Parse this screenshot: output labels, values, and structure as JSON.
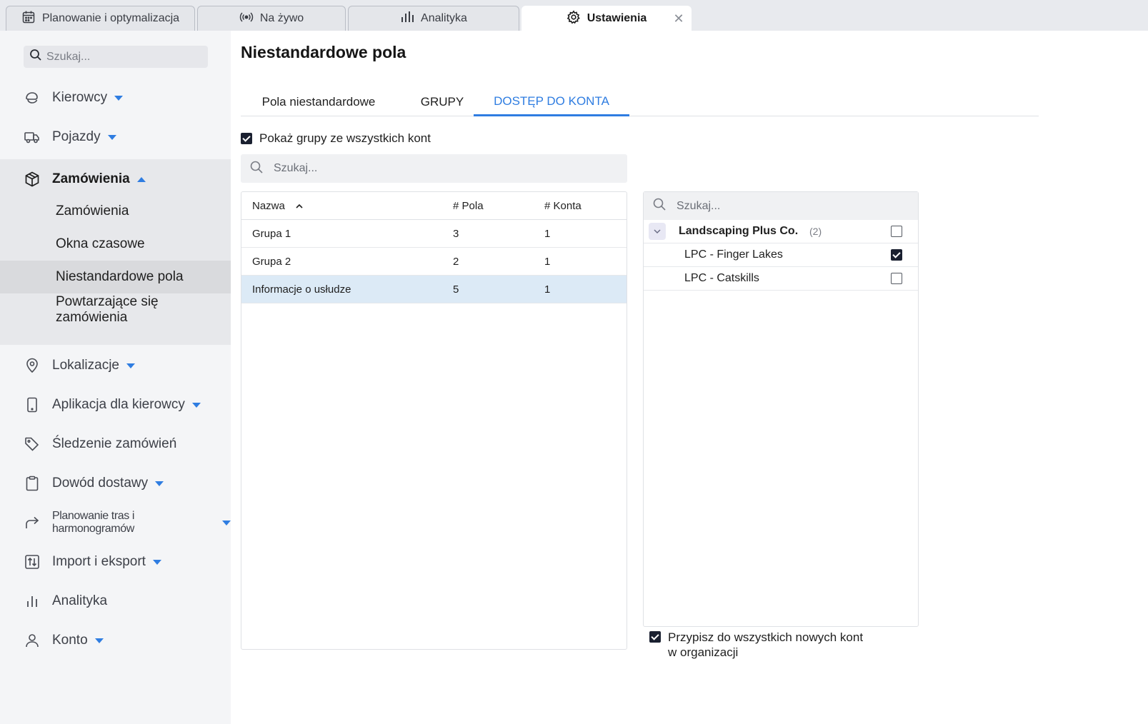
{
  "tabs": [
    {
      "label": "Planowanie i optymalizacja",
      "icon": "calendar-icon"
    },
    {
      "label": "Na żywo",
      "icon": "broadcast-icon"
    },
    {
      "label": "Analityka",
      "icon": "bar-chart-icon"
    },
    {
      "label": "Ustawienia",
      "icon": "gear-icon",
      "active": true
    }
  ],
  "tab_close": "✕",
  "sidebar": {
    "search_placeholder": "Szukaj...",
    "items": [
      {
        "label": "Kierowcy",
        "icon": "driver-icon",
        "caret": "down"
      },
      {
        "label": "Pojazdy",
        "icon": "truck-icon",
        "caret": "down"
      },
      {
        "label": "Zamówienia",
        "icon": "box-icon",
        "caret": "up",
        "open": true
      },
      {
        "label": "Lokalizacje",
        "icon": "location-pin-icon",
        "caret": "down"
      },
      {
        "label": "Aplikacja dla kierowcy",
        "icon": "phone-icon",
        "caret": "down"
      },
      {
        "label": "Śledzenie zamówień",
        "icon": "tag-icon"
      },
      {
        "label": "Dowód dostawy",
        "icon": "clipboard-icon",
        "caret": "down"
      },
      {
        "label": "Planowanie tras i harmonogramów",
        "icon": "route-arrow-icon",
        "caret": "down"
      },
      {
        "label": "Import i eksport",
        "icon": "import-export-icon",
        "caret": "down"
      },
      {
        "label": "Analityka",
        "icon": "analytics-icon"
      },
      {
        "label": "Konto",
        "icon": "user-icon",
        "caret": "down"
      }
    ],
    "sub_items": [
      {
        "label": "Zamówienia"
      },
      {
        "label": "Okna czasowe"
      },
      {
        "label": "Niestandardowe pola",
        "selected": true
      },
      {
        "label": "Powtarzające się zamówienia"
      }
    ]
  },
  "main": {
    "title": "Niestandardowe pola",
    "subtabs": [
      {
        "label": "Pola niestandardowe"
      },
      {
        "label": "GRUPY"
      },
      {
        "label": "DOSTĘP DO KONTA",
        "active": true
      }
    ],
    "show_all_label": "Pokaż grupy ze wszystkich kont",
    "show_all_checked": true,
    "search_placeholder": "Szukaj...",
    "groups_table": {
      "columns": [
        "Nazwa",
        "# Pola",
        "# Konta"
      ],
      "rows": [
        {
          "name": "Grupa 1",
          "fields": "3",
          "accounts": "1"
        },
        {
          "name": "Grupa 2",
          "fields": "2",
          "accounts": "1"
        },
        {
          "name": "Informacje o usłudze",
          "fields": "5",
          "accounts": "1",
          "selected": true
        }
      ]
    },
    "accounts_panel": {
      "search_placeholder": "Szukaj...",
      "org": {
        "name": "Landscaping Plus Co.",
        "count": "(2)",
        "checked": false
      },
      "children": [
        {
          "name": "LPC - Finger Lakes",
          "checked": true
        },
        {
          "name": "LPC - Catskills",
          "checked": false
        }
      ]
    },
    "assign_line1": "Przypisz do wszystkich nowych kont",
    "assign_line2": "w organizacji",
    "assign_checked": true
  },
  "colors": {
    "accent": "#2f7de1",
    "selected_row": "#dceaf6",
    "sidebar_bg": "#f4f5f7"
  }
}
